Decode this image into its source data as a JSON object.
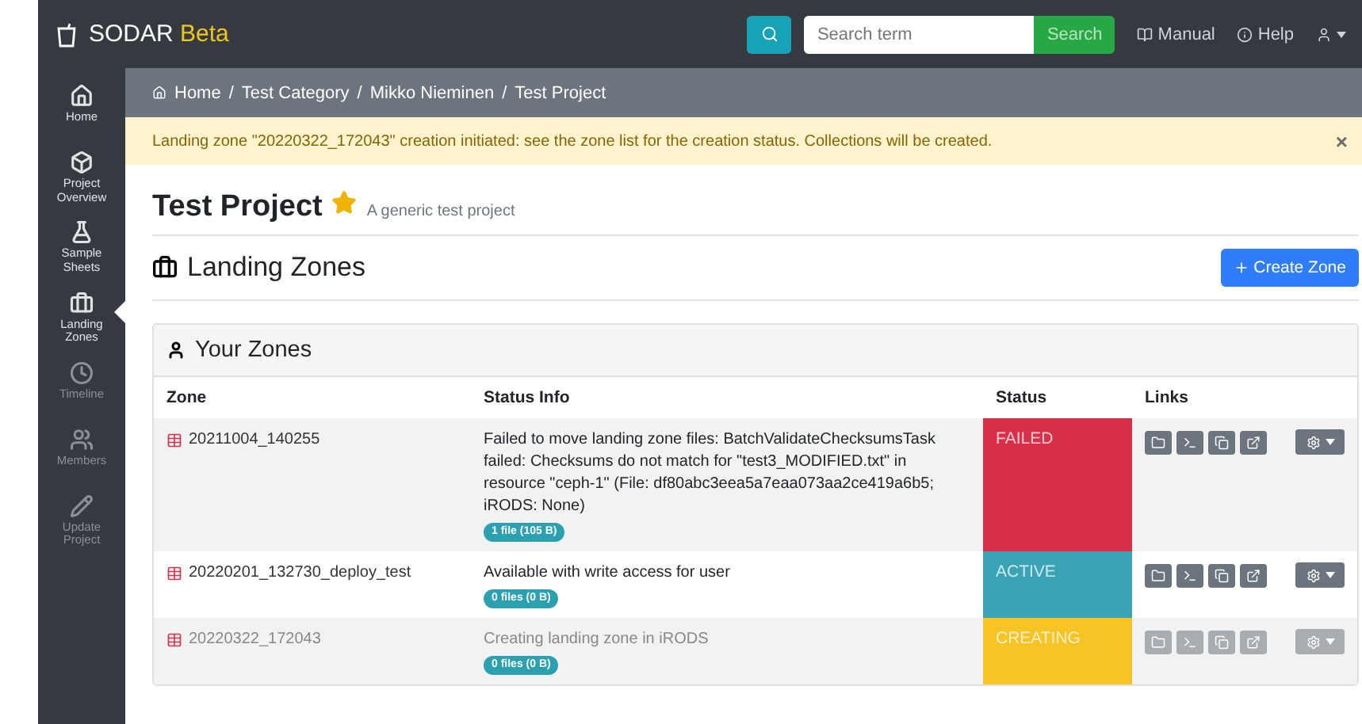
{
  "brand": {
    "name": "SODAR",
    "tag": "Beta"
  },
  "search": {
    "placeholder": "Search term",
    "button": "Search"
  },
  "nav_links": [
    {
      "kind": "manual",
      "label": "Manual"
    },
    {
      "kind": "help",
      "label": "Help"
    }
  ],
  "sidebar": {
    "items": [
      {
        "kind": "home",
        "label": "Home",
        "selected": false,
        "disabled": false
      },
      {
        "kind": "overview",
        "label": "Project Overview",
        "selected": false,
        "disabled": false
      },
      {
        "kind": "sheets",
        "label": "Sample Sheets",
        "selected": false,
        "disabled": false
      },
      {
        "kind": "zones",
        "label": "Landing Zones",
        "selected": true,
        "disabled": false
      },
      {
        "kind": "timeline",
        "label": "Timeline",
        "selected": false,
        "disabled": true
      },
      {
        "kind": "members",
        "label": "Members",
        "selected": false,
        "disabled": true
      },
      {
        "kind": "update",
        "label": "Update Project",
        "selected": false,
        "disabled": true
      }
    ]
  },
  "breadcrumb": [
    "Home",
    "Test Category",
    "Mikko Nieminen",
    "Test Project"
  ],
  "breadcrumb_separator": "/",
  "alert": {
    "text": "Landing zone \"20220322_172043\" creation initiated: see the zone list for the creation status. Collections will be created.",
    "close": "×"
  },
  "project": {
    "title": "Test Project",
    "starred": true,
    "description": "A generic test project"
  },
  "section": {
    "title": "Landing Zones",
    "button": "Create Zone"
  },
  "card": {
    "title": "Your Zones",
    "table": {
      "columns": [
        "Zone",
        "Status Info",
        "Status",
        "Links"
      ],
      "rows": [
        {
          "zone": "20211004_140255",
          "info": "Failed to move landing zone files: BatchValidateChecksumsTask failed: Checksums do not match for \"test3_MODIFIED.txt\" in resource \"ceph-1\" (File: df80abc3eea5a7eaa073aa2ce419a6b5; iRODS: None)",
          "files": "1 file (105 B)",
          "status": "FAILED",
          "kind": "failed",
          "disabled": false
        },
        {
          "zone": "20220201_132730_deploy_test",
          "info": "Available with write access for user",
          "files": "0 files (0 B)",
          "status": "ACTIVE",
          "kind": "active",
          "disabled": false
        },
        {
          "zone": "20220322_172043",
          "info": "Creating landing zone in iRODS",
          "files": "0 files (0 B)",
          "status": "CREATING",
          "kind": "creating",
          "disabled": true
        }
      ]
    }
  }
}
